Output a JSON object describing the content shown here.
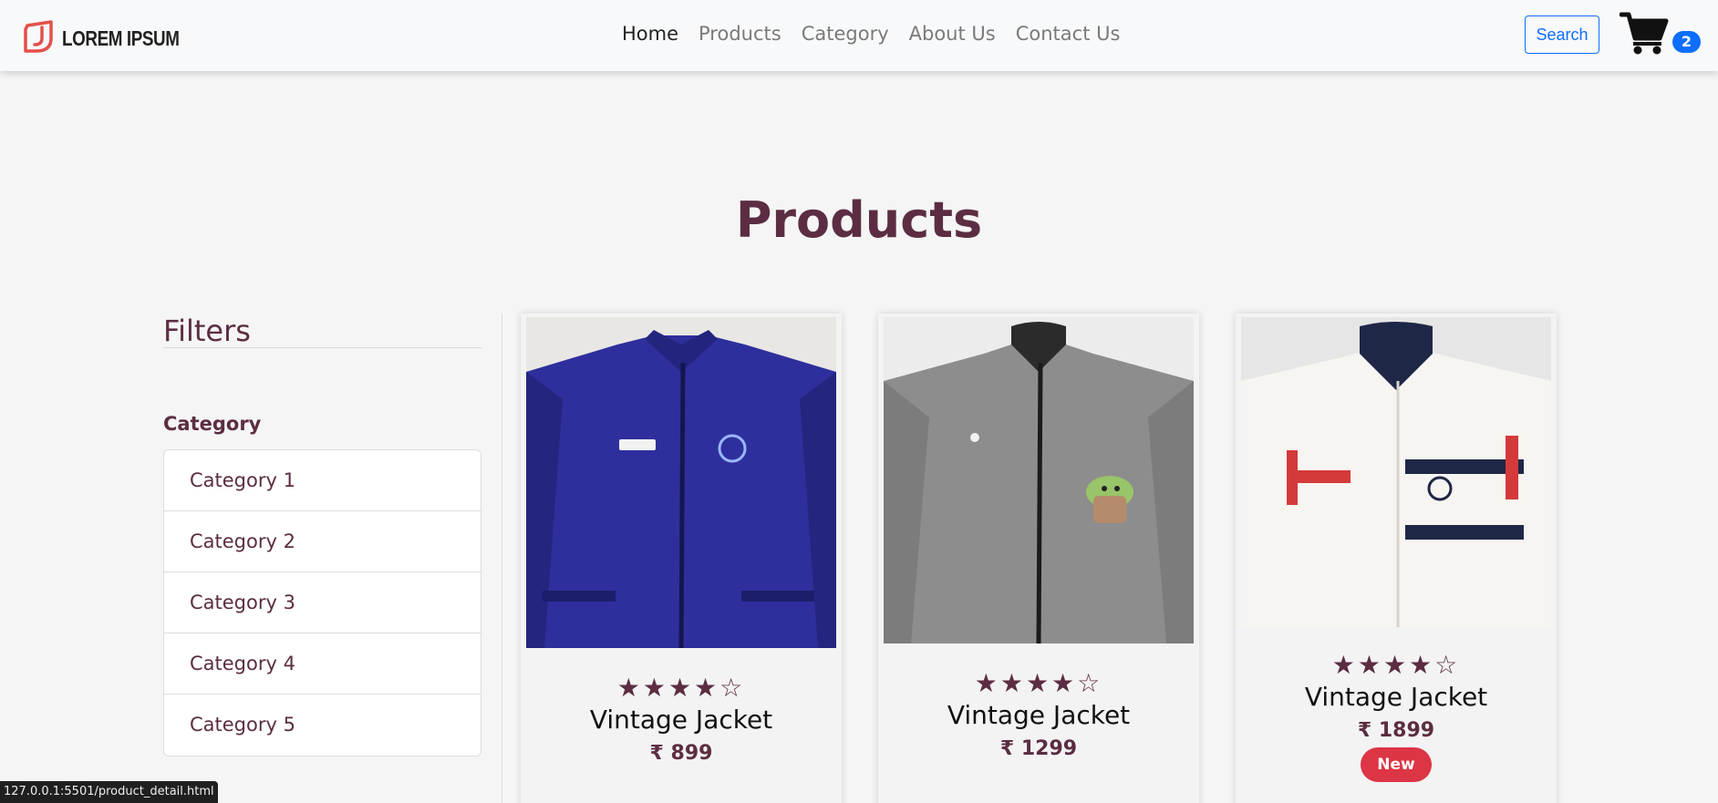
{
  "navbar": {
    "brand": "LOREM IPSUM",
    "links": [
      "Home",
      "Products",
      "Category",
      "About Us",
      "Contact Us"
    ],
    "active_link": "Home",
    "search_label": "Search",
    "cart_count": "2",
    "accent_color": "#0d6efd"
  },
  "page": {
    "title": "Products"
  },
  "filters": {
    "title": "Filters",
    "category_label": "Category",
    "categories": [
      "Category 1",
      "Category 2",
      "Category 3",
      "Category 4",
      "Category 5"
    ]
  },
  "products": [
    {
      "name": "Vintage Jacket",
      "price": "₹ 899",
      "rating": 4,
      "max_rating": 5,
      "badge": "",
      "image": "blue-jacket"
    },
    {
      "name": "Vintage Jacket",
      "price": "₹ 1299",
      "rating": 4,
      "max_rating": 5,
      "badge": "",
      "image": "grey-jacket"
    },
    {
      "name": "Vintage Jacket",
      "price": "₹ 1899",
      "rating": 4,
      "max_rating": 5,
      "badge": "New",
      "image": "white-jacket"
    }
  ],
  "colors": {
    "primary_text": "#5c2d42",
    "badge_new": "#dc3545"
  },
  "statusbar": {
    "url": "127.0.0.1:5501/product_detail.html"
  }
}
